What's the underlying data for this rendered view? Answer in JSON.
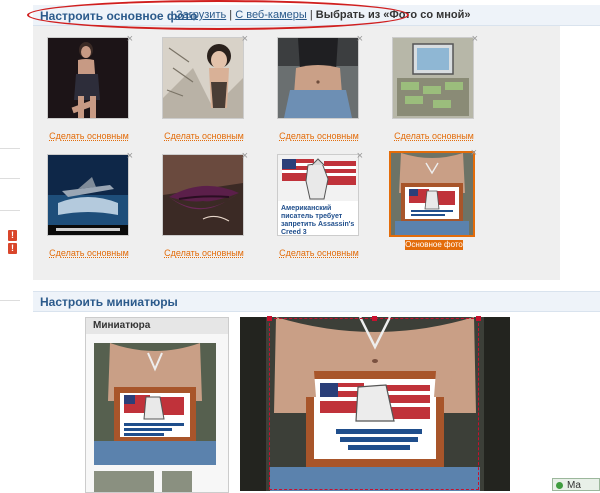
{
  "main_photo": {
    "title": "Настроить основное фото",
    "link_upload": "Загрузить",
    "sep1": " | ",
    "link_webcam": "С веб-камеры",
    "sep2": " | ",
    "selected_option": "Выбрать из «Фото со мной»",
    "close_glyph": "×",
    "make_main_label": "Сделать основным",
    "current_main_label": "Основное фото",
    "photos": [
      {
        "id": "p1",
        "theme": "woman-dark"
      },
      {
        "id": "p2",
        "theme": "woman-sketch"
      },
      {
        "id": "p3",
        "theme": "woman-jeans"
      },
      {
        "id": "p4",
        "theme": "desk-money"
      },
      {
        "id": "p5",
        "theme": "jet-water"
      },
      {
        "id": "p6",
        "theme": "lips"
      },
      {
        "id": "p7",
        "theme": "article-assassins-creed",
        "caption": "Американский писатель требует запретить Assassin's Creed 3"
      },
      {
        "id": "p8",
        "theme": "frame-hips",
        "current": true
      }
    ]
  },
  "thumbnails": {
    "title": "Настроить миниатюры",
    "preview_title": "Миниатюра",
    "frame_caption": "Американский писатель требует запретить Assassin's Creed 3"
  },
  "status_bar": {
    "label": "Ma"
  },
  "colors": {
    "accent_orange": "#e36c0a",
    "header_blue": "#2b5a8b",
    "annotation_red": "#d01f1f"
  }
}
